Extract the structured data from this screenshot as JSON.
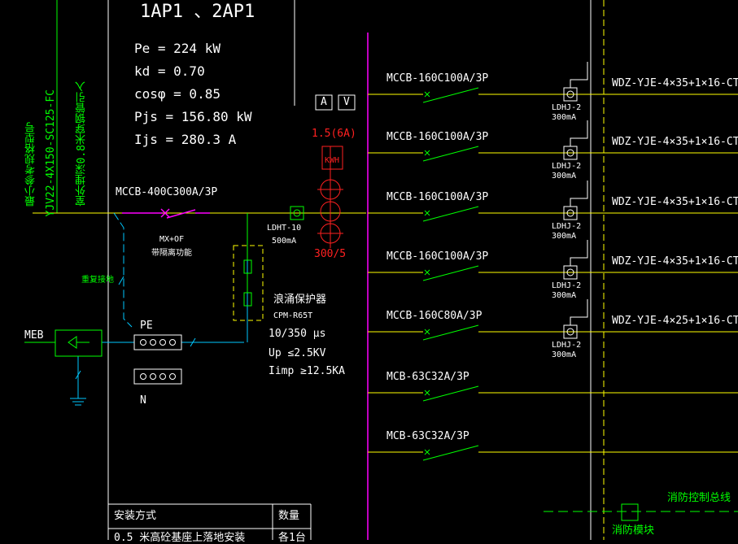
{
  "panel_title": "1AP1  、2AP1",
  "params": {
    "pe": "Pe = 224 kW",
    "kd": "kd = 0.70",
    "cos": "cosφ = 0.85",
    "pjs": "Pjs = 156.80 kW",
    "ijs": "Ijs = 280.3 A"
  },
  "incoming": {
    "note1": "最小参考规格型号",
    "note2": "YJV22-4X150-SC125-FC",
    "note3": "室外埋深0.8米穿钢管引入",
    "main_breaker": "MCCB-400C300A/3P",
    "mx": "MX+OF",
    "mx_note": "带隔离功能",
    "rcd": "LDHT-10",
    "rcd_ma": "500mA",
    "repeat_ground": "重复接地"
  },
  "meters": {
    "a": "A",
    "v": "V",
    "fuse": "1.5(6A)",
    "kwh": "KWH",
    "ct": "300/5"
  },
  "spd": {
    "title": "浪涌保护器",
    "model": "CPM-R65T",
    "wave": "10/350   μs",
    "up": "Up ≤2.5KV",
    "iimp": "Iimp ≥12.5KA"
  },
  "bars": {
    "pe": "PE",
    "n": "N",
    "meb": "MEB"
  },
  "circuits": [
    {
      "breaker": "MCCB-160C100A/3P",
      "rcd": "LDHJ-2",
      "ma": "300mA",
      "cable": "WDZ-YJE-4×35+1×16-CT"
    },
    {
      "breaker": "MCCB-160C100A/3P",
      "rcd": "LDHJ-2",
      "ma": "300mA",
      "cable": "WDZ-YJE-4×35+1×16-CT"
    },
    {
      "breaker": "MCCB-160C100A/3P",
      "rcd": "LDHJ-2",
      "ma": "300mA",
      "cable": "WDZ-YJE-4×35+1×16-CT"
    },
    {
      "breaker": "MCCB-160C100A/3P",
      "rcd": "LDHJ-2",
      "ma": "300mA",
      "cable": "WDZ-YJE-4×35+1×16-CT"
    },
    {
      "breaker": "MCCB-160C80A/3P",
      "rcd": "LDHJ-2",
      "ma": "300mA",
      "cable": "WDZ-YJE-4×25+1×16-CT"
    },
    {
      "breaker": "MCB-63C32A/3P",
      "rcd": "",
      "ma": "",
      "cable": ""
    },
    {
      "breaker": "MCB-63C32A/3P",
      "rcd": "",
      "ma": "",
      "cable": ""
    }
  ],
  "fire": {
    "bus": "消防控制总线",
    "module": "消防模块"
  },
  "table": {
    "h1": "安装方式",
    "h2": "数量",
    "r1c1": "0.5  米高砼基座上落地安装",
    "r1c2": "各1台"
  },
  "colors": {
    "bg": "#000000",
    "yellow": "#ffff00",
    "magenta": "#ff00ff",
    "green": "#00ff00",
    "cyan": "#00c8ff",
    "red": "#ff2020",
    "white": "#ffffff"
  }
}
